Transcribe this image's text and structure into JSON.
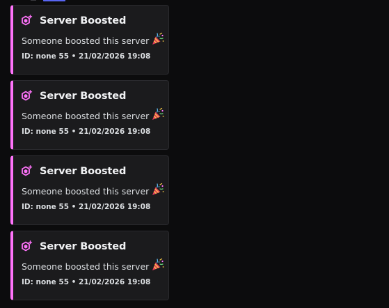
{
  "embeds": [
    {
      "title": "Server Boosted",
      "description": "Someone boosted this server",
      "footer": "ID: none 55 • 21/02/2026 19:08",
      "title_icon": "nitro-boost-icon",
      "desc_icon": "party-popper-icon",
      "accent_color": "#ff73fa"
    },
    {
      "title": "Server Boosted",
      "description": "Someone boosted this server",
      "footer": "ID: none 55 • 21/02/2026 19:08",
      "title_icon": "nitro-boost-icon",
      "desc_icon": "party-popper-icon",
      "accent_color": "#ff73fa"
    },
    {
      "title": "Server Boosted",
      "description": "Someone boosted this server",
      "footer": "ID: none 55 • 21/02/2026 19:08",
      "title_icon": "nitro-boost-icon",
      "desc_icon": "party-popper-icon",
      "accent_color": "#ff73fa"
    },
    {
      "title": "Server Boosted",
      "description": "Someone boosted this server",
      "footer": "ID: none 55 • 21/02/2026 19:08",
      "title_icon": "nitro-boost-icon",
      "desc_icon": "party-popper-icon",
      "accent_color": "#ff73fa"
    }
  ],
  "colors": {
    "background": "#0c0c0d",
    "embed_background": "#1b1b1d",
    "accent": "#ff73fa",
    "title_text": "#f2f3f5",
    "body_text": "#dbdee1"
  }
}
